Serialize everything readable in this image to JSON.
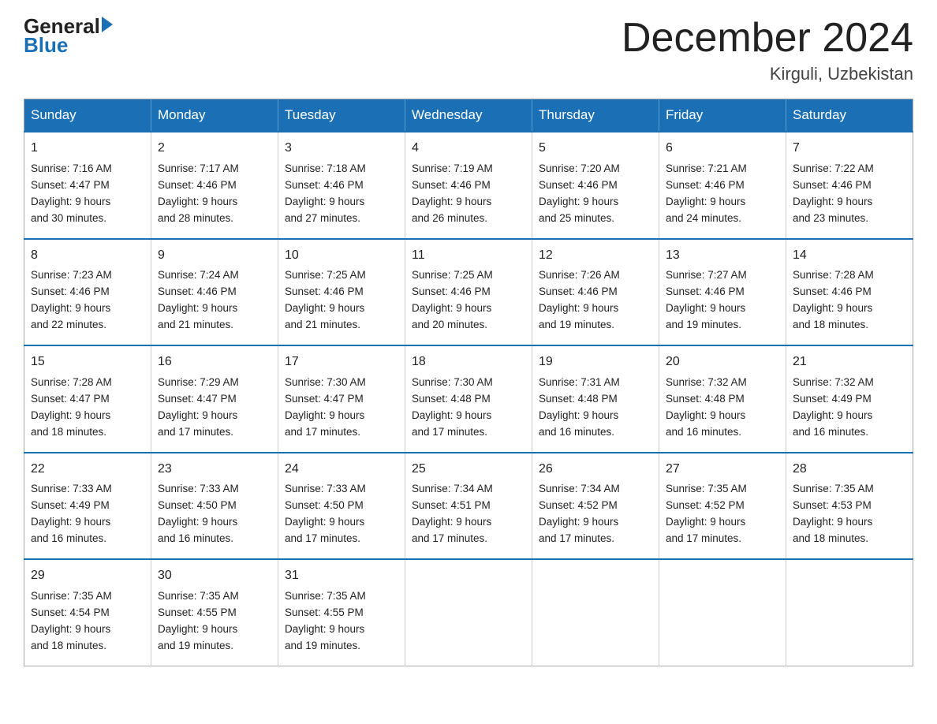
{
  "logo": {
    "general": "General",
    "arrow": "▶",
    "blue": "Blue"
  },
  "header": {
    "month_title": "December 2024",
    "location": "Kirguli, Uzbekistan"
  },
  "weekdays": [
    "Sunday",
    "Monday",
    "Tuesday",
    "Wednesday",
    "Thursday",
    "Friday",
    "Saturday"
  ],
  "weeks": [
    [
      {
        "day": "1",
        "sunrise": "7:16 AM",
        "sunset": "4:47 PM",
        "daylight": "9 hours and 30 minutes."
      },
      {
        "day": "2",
        "sunrise": "7:17 AM",
        "sunset": "4:46 PM",
        "daylight": "9 hours and 28 minutes."
      },
      {
        "day": "3",
        "sunrise": "7:18 AM",
        "sunset": "4:46 PM",
        "daylight": "9 hours and 27 minutes."
      },
      {
        "day": "4",
        "sunrise": "7:19 AM",
        "sunset": "4:46 PM",
        "daylight": "9 hours and 26 minutes."
      },
      {
        "day": "5",
        "sunrise": "7:20 AM",
        "sunset": "4:46 PM",
        "daylight": "9 hours and 25 minutes."
      },
      {
        "day": "6",
        "sunrise": "7:21 AM",
        "sunset": "4:46 PM",
        "daylight": "9 hours and 24 minutes."
      },
      {
        "day": "7",
        "sunrise": "7:22 AM",
        "sunset": "4:46 PM",
        "daylight": "9 hours and 23 minutes."
      }
    ],
    [
      {
        "day": "8",
        "sunrise": "7:23 AM",
        "sunset": "4:46 PM",
        "daylight": "9 hours and 22 minutes."
      },
      {
        "day": "9",
        "sunrise": "7:24 AM",
        "sunset": "4:46 PM",
        "daylight": "9 hours and 21 minutes."
      },
      {
        "day": "10",
        "sunrise": "7:25 AM",
        "sunset": "4:46 PM",
        "daylight": "9 hours and 21 minutes."
      },
      {
        "day": "11",
        "sunrise": "7:25 AM",
        "sunset": "4:46 PM",
        "daylight": "9 hours and 20 minutes."
      },
      {
        "day": "12",
        "sunrise": "7:26 AM",
        "sunset": "4:46 PM",
        "daylight": "9 hours and 19 minutes."
      },
      {
        "day": "13",
        "sunrise": "7:27 AM",
        "sunset": "4:46 PM",
        "daylight": "9 hours and 19 minutes."
      },
      {
        "day": "14",
        "sunrise": "7:28 AM",
        "sunset": "4:46 PM",
        "daylight": "9 hours and 18 minutes."
      }
    ],
    [
      {
        "day": "15",
        "sunrise": "7:28 AM",
        "sunset": "4:47 PM",
        "daylight": "9 hours and 18 minutes."
      },
      {
        "day": "16",
        "sunrise": "7:29 AM",
        "sunset": "4:47 PM",
        "daylight": "9 hours and 17 minutes."
      },
      {
        "day": "17",
        "sunrise": "7:30 AM",
        "sunset": "4:47 PM",
        "daylight": "9 hours and 17 minutes."
      },
      {
        "day": "18",
        "sunrise": "7:30 AM",
        "sunset": "4:48 PM",
        "daylight": "9 hours and 17 minutes."
      },
      {
        "day": "19",
        "sunrise": "7:31 AM",
        "sunset": "4:48 PM",
        "daylight": "9 hours and 16 minutes."
      },
      {
        "day": "20",
        "sunrise": "7:32 AM",
        "sunset": "4:48 PM",
        "daylight": "9 hours and 16 minutes."
      },
      {
        "day": "21",
        "sunrise": "7:32 AM",
        "sunset": "4:49 PM",
        "daylight": "9 hours and 16 minutes."
      }
    ],
    [
      {
        "day": "22",
        "sunrise": "7:33 AM",
        "sunset": "4:49 PM",
        "daylight": "9 hours and 16 minutes."
      },
      {
        "day": "23",
        "sunrise": "7:33 AM",
        "sunset": "4:50 PM",
        "daylight": "9 hours and 16 minutes."
      },
      {
        "day": "24",
        "sunrise": "7:33 AM",
        "sunset": "4:50 PM",
        "daylight": "9 hours and 17 minutes."
      },
      {
        "day": "25",
        "sunrise": "7:34 AM",
        "sunset": "4:51 PM",
        "daylight": "9 hours and 17 minutes."
      },
      {
        "day": "26",
        "sunrise": "7:34 AM",
        "sunset": "4:52 PM",
        "daylight": "9 hours and 17 minutes."
      },
      {
        "day": "27",
        "sunrise": "7:35 AM",
        "sunset": "4:52 PM",
        "daylight": "9 hours and 17 minutes."
      },
      {
        "day": "28",
        "sunrise": "7:35 AM",
        "sunset": "4:53 PM",
        "daylight": "9 hours and 18 minutes."
      }
    ],
    [
      {
        "day": "29",
        "sunrise": "7:35 AM",
        "sunset": "4:54 PM",
        "daylight": "9 hours and 18 minutes."
      },
      {
        "day": "30",
        "sunrise": "7:35 AM",
        "sunset": "4:55 PM",
        "daylight": "9 hours and 19 minutes."
      },
      {
        "day": "31",
        "sunrise": "7:35 AM",
        "sunset": "4:55 PM",
        "daylight": "9 hours and 19 minutes."
      },
      null,
      null,
      null,
      null
    ]
  ]
}
